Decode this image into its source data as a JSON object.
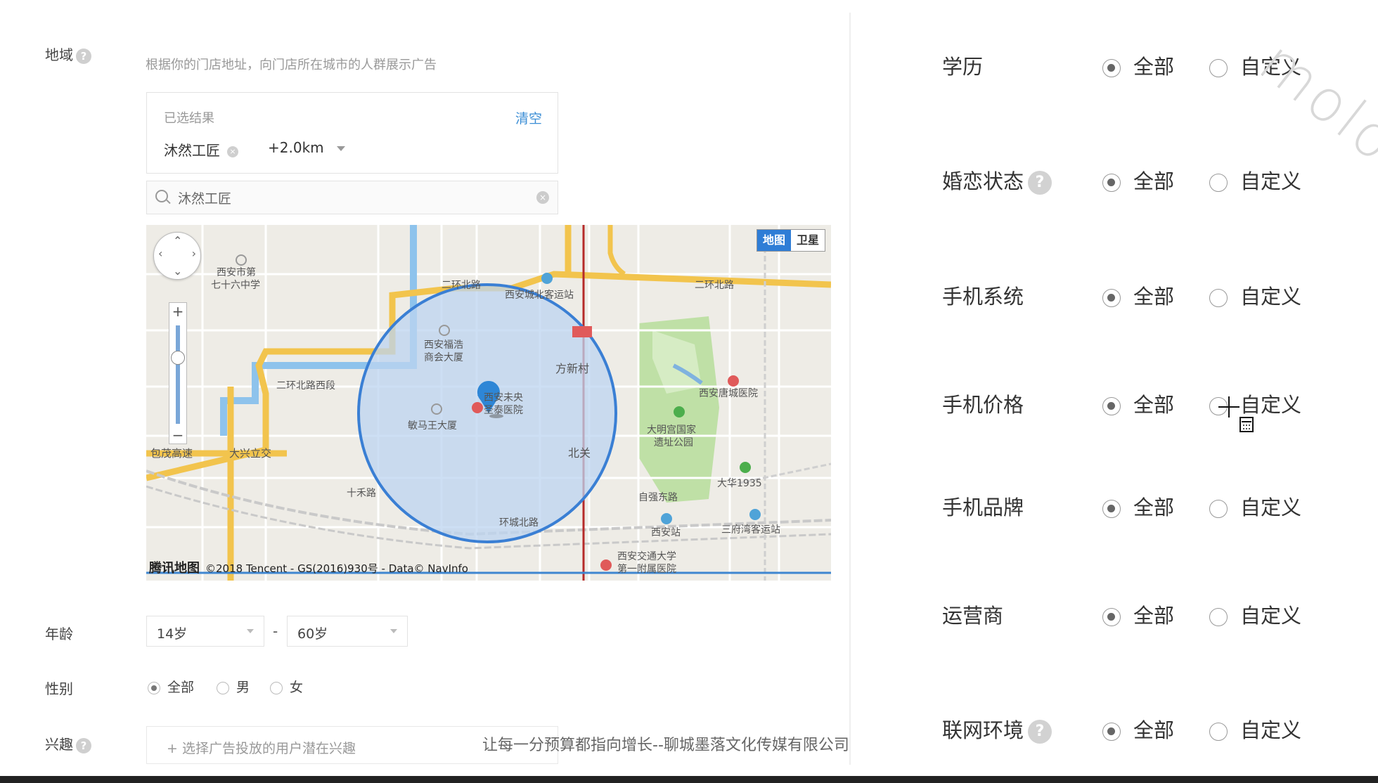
{
  "left": {
    "region_label": "地域",
    "region_hint": "根据你的门店地址，向门店所在城市的人群展示广告",
    "selected": {
      "title": "已选结果",
      "clear": "清空",
      "chip": "沐然工匠",
      "radius": "+2.0km"
    },
    "search": {
      "value": "沐然工匠"
    },
    "map": {
      "type_map": "地图",
      "type_satellite": "卫星",
      "brand": "腾讯地图",
      "copyright": "©2018 Tencent - GS(2016)930号 - Data© NavInfo",
      "labels": [
        "西安市第七十六中学",
        "二环北路",
        "西安城北客运站",
        "西安福浩商会大厦",
        "方新村",
        "西安未央圣泰医院",
        "敏马王大厦",
        "二环北路西段",
        "北关",
        "包茂高速",
        "大兴立交",
        "大明宫国家遗址公园",
        "西安唐城医院",
        "大华1935",
        "十禾路",
        "自强东路",
        "西安站",
        "三府湾客运站",
        "西安交通大学第一附属医院",
        "环城北路"
      ]
    },
    "age_label": "年龄",
    "age_from": "14岁",
    "age_dash": "-",
    "age_to": "60岁",
    "gender_label": "性别",
    "gender_options": [
      "全部",
      "男",
      "女"
    ],
    "interest_label": "兴趣",
    "interest_placeholder": "+ 选择广告投放的用户潜在兴趣"
  },
  "right": {
    "rows": [
      {
        "label": "学历",
        "help": false
      },
      {
        "label": "婚恋状态",
        "help": true
      },
      {
        "label": "手机系统",
        "help": false
      },
      {
        "label": "手机价格",
        "help": false
      },
      {
        "label": "手机品牌",
        "help": false
      },
      {
        "label": "运营商",
        "help": false
      },
      {
        "label": "联网环境",
        "help": true
      }
    ],
    "option_all": "全部",
    "option_custom": "自定义",
    "help_icon": "?"
  },
  "footer": "让每一分预算都指向增长--聊城墨落文化传媒有限公司",
  "watermark": "molo",
  "colors": {
    "accent": "#3d8fd6",
    "circle": "#3a7fd4",
    "circle_fill": "#bcd4f0"
  }
}
